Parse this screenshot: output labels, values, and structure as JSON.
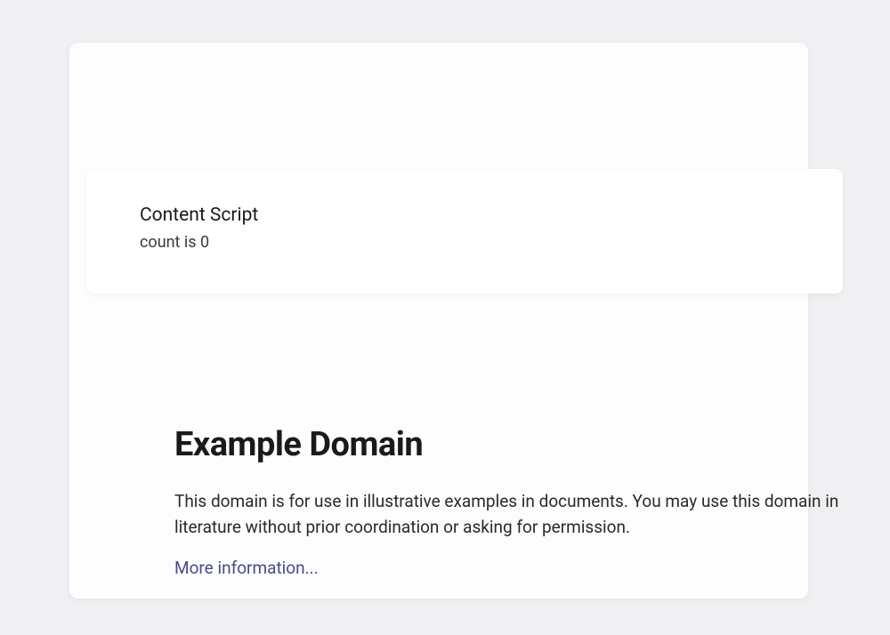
{
  "overlay": {
    "title": "Content Script",
    "count_label": "count is 0"
  },
  "page": {
    "heading": "Example Domain",
    "paragraph": "This domain is for use in illustrative examples in documents. You may use this domain in literature without prior coordination or asking for permission.",
    "link_text": "More information..."
  }
}
